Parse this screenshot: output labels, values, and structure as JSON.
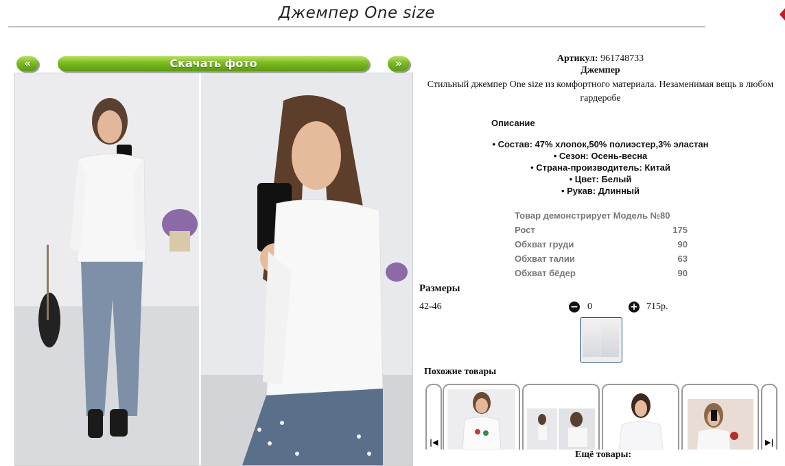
{
  "page": {
    "title": "Джемпер One size"
  },
  "nav": {
    "prev_label": "«",
    "download_label": "Скачать фото",
    "next_label": "»"
  },
  "product": {
    "sku_label": "Артикул:",
    "sku_value": "961748733",
    "name": "Джемпер",
    "description": "Стильный джемпер One size из комфортного материала. Незаменимая вещь в любом гардеробе",
    "description_title": "Описание",
    "properties": [
      "• Состав: 47% хлопок,50% полиэстер,3% эластан",
      "• Сезон: Осень-весна",
      "• Страна-производитель: Китай",
      "• Цвет: Белый",
      "• Рукав: Длинный"
    ],
    "model": [
      {
        "label": "Товар демонстрирует Модель №80",
        "value": ""
      },
      {
        "label": "Рост",
        "value": "175"
      },
      {
        "label": "Обхват груди",
        "value": "90"
      },
      {
        "label": "Обхват талии",
        "value": "63"
      },
      {
        "label": "Обхват бёдер",
        "value": "90"
      }
    ],
    "sizes_title": "Размеры",
    "size_row": {
      "size": "42-46",
      "quantity": "0",
      "price": "715р."
    }
  },
  "similar": {
    "title": "Похожие товары",
    "more_title": "Ещё товары:",
    "items": [
      {
        "icon": "photo-sweater-floral-print"
      },
      {
        "icon": "photo-white-jumper-two-view"
      },
      {
        "icon": "photo-white-sweater-woman"
      },
      {
        "icon": "photo-white-sweater-selfie"
      }
    ]
  },
  "icons": {
    "minus": "minus-circle-icon",
    "plus": "plus-circle-icon",
    "prev": "skip-back-icon",
    "next": "skip-forward-icon"
  },
  "colors": {
    "button_green": "#7cba20",
    "accent_red": "#c41b22"
  }
}
